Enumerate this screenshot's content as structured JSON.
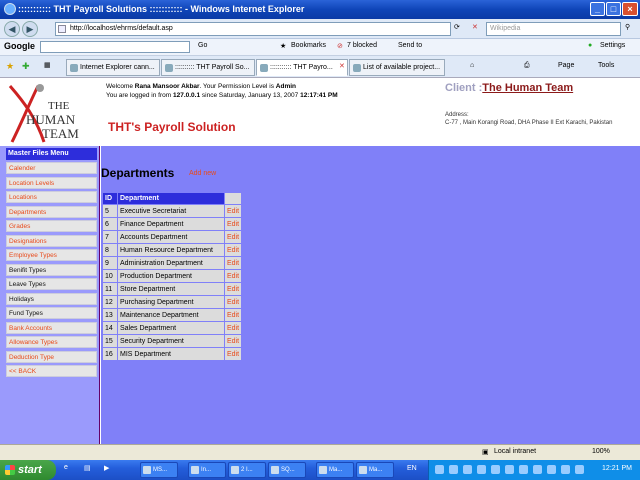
{
  "window": {
    "title": "::::::::::: THT Payroll Solutions ::::::::::: - Windows Internet Explorer",
    "address": "http://localhost/ehrms/default.asp",
    "search_placeholder": "Wikipedia"
  },
  "googlebar": {
    "google_label": "Google",
    "go": "Go",
    "bookmarks": "Bookmarks",
    "blocked": "7 blocked",
    "send_to": "Send to",
    "settings": "Settings"
  },
  "tabs": [
    {
      "label": "Internet Explorer cann..."
    },
    {
      "label": ":::::::::: THT Payroll So..."
    },
    {
      "label": "::::::::::: THT Payro..."
    },
    {
      "label": "List of available project..."
    }
  ],
  "toolbar_right": {
    "page": "Page",
    "tools": "Tools"
  },
  "header": {
    "logo_line1": "THE",
    "logo_line2": "HUMAN",
    "logo_line3": "TEAM",
    "welcome_prefix": "Welcome ",
    "user_name": "Rana Mansoor Akbar",
    "permission_text": ". Your Permission Level is ",
    "permission_level": "Admin",
    "logged_from_text": "You are logged in from ",
    "ip": "127.0.0.1",
    "since_text": " since Saturday, January 13, 2007 ",
    "time": "12:17:41 PM",
    "app_title": "THT's Payroll Solution",
    "client_label": "Client :",
    "client_name": "The Human Team",
    "address_label": "Address:",
    "address_value": "C-77 , Main Korangi Road, DHA Phase II Ext Karachi, Pakistan"
  },
  "sidebar": {
    "heading": "Master Files Menu",
    "items": [
      {
        "label": "Calender",
        "style": "red"
      },
      {
        "label": "Location Levels",
        "style": "red"
      },
      {
        "label": "Locations",
        "style": "red"
      },
      {
        "label": "Departments",
        "style": "red"
      },
      {
        "label": "Grades",
        "style": "red"
      },
      {
        "label": "Designations",
        "style": "red"
      },
      {
        "label": "Employee Types",
        "style": "red"
      },
      {
        "label": "Benifit Types",
        "style": "blk"
      },
      {
        "label": "Leave Types",
        "style": "blk"
      },
      {
        "label": "Holidays",
        "style": "blk"
      },
      {
        "label": "Fund Types",
        "style": "blk"
      },
      {
        "label": "Bank Accounts",
        "style": "red"
      },
      {
        "label": "Allowance Types",
        "style": "red"
      },
      {
        "label": "Deduction Type",
        "style": "red"
      },
      {
        "label": "<< BACK",
        "style": "red"
      }
    ]
  },
  "main": {
    "title": "Departments",
    "add_new": "Add new",
    "columns": [
      "ID",
      "Department"
    ],
    "edit_label": "Edit",
    "rows": [
      {
        "id": "5",
        "name": "Executive Secretariat"
      },
      {
        "id": "6",
        "name": "Finance Department"
      },
      {
        "id": "7",
        "name": "Accounts Department"
      },
      {
        "id": "8",
        "name": "Human Resource Department"
      },
      {
        "id": "9",
        "name": "Administration Department"
      },
      {
        "id": "10",
        "name": "Production Department"
      },
      {
        "id": "11",
        "name": "Store Department"
      },
      {
        "id": "12",
        "name": "Purchasing Department"
      },
      {
        "id": "13",
        "name": "Maintenance Department"
      },
      {
        "id": "14",
        "name": "Sales Department"
      },
      {
        "id": "15",
        "name": "Security Department"
      },
      {
        "id": "16",
        "name": "MIS Department"
      }
    ]
  },
  "status": {
    "zone": "Local intranet",
    "zoom": "100%"
  },
  "taskbar": {
    "start": "start",
    "buttons": [
      {
        "label": "MS..."
      },
      {
        "label": "In..."
      },
      {
        "label": "2 I..."
      },
      {
        "label": "SQ..."
      },
      {
        "label": "Ma..."
      },
      {
        "label": "Ma..."
      }
    ],
    "lang": "EN",
    "clock": "12:21 PM"
  }
}
